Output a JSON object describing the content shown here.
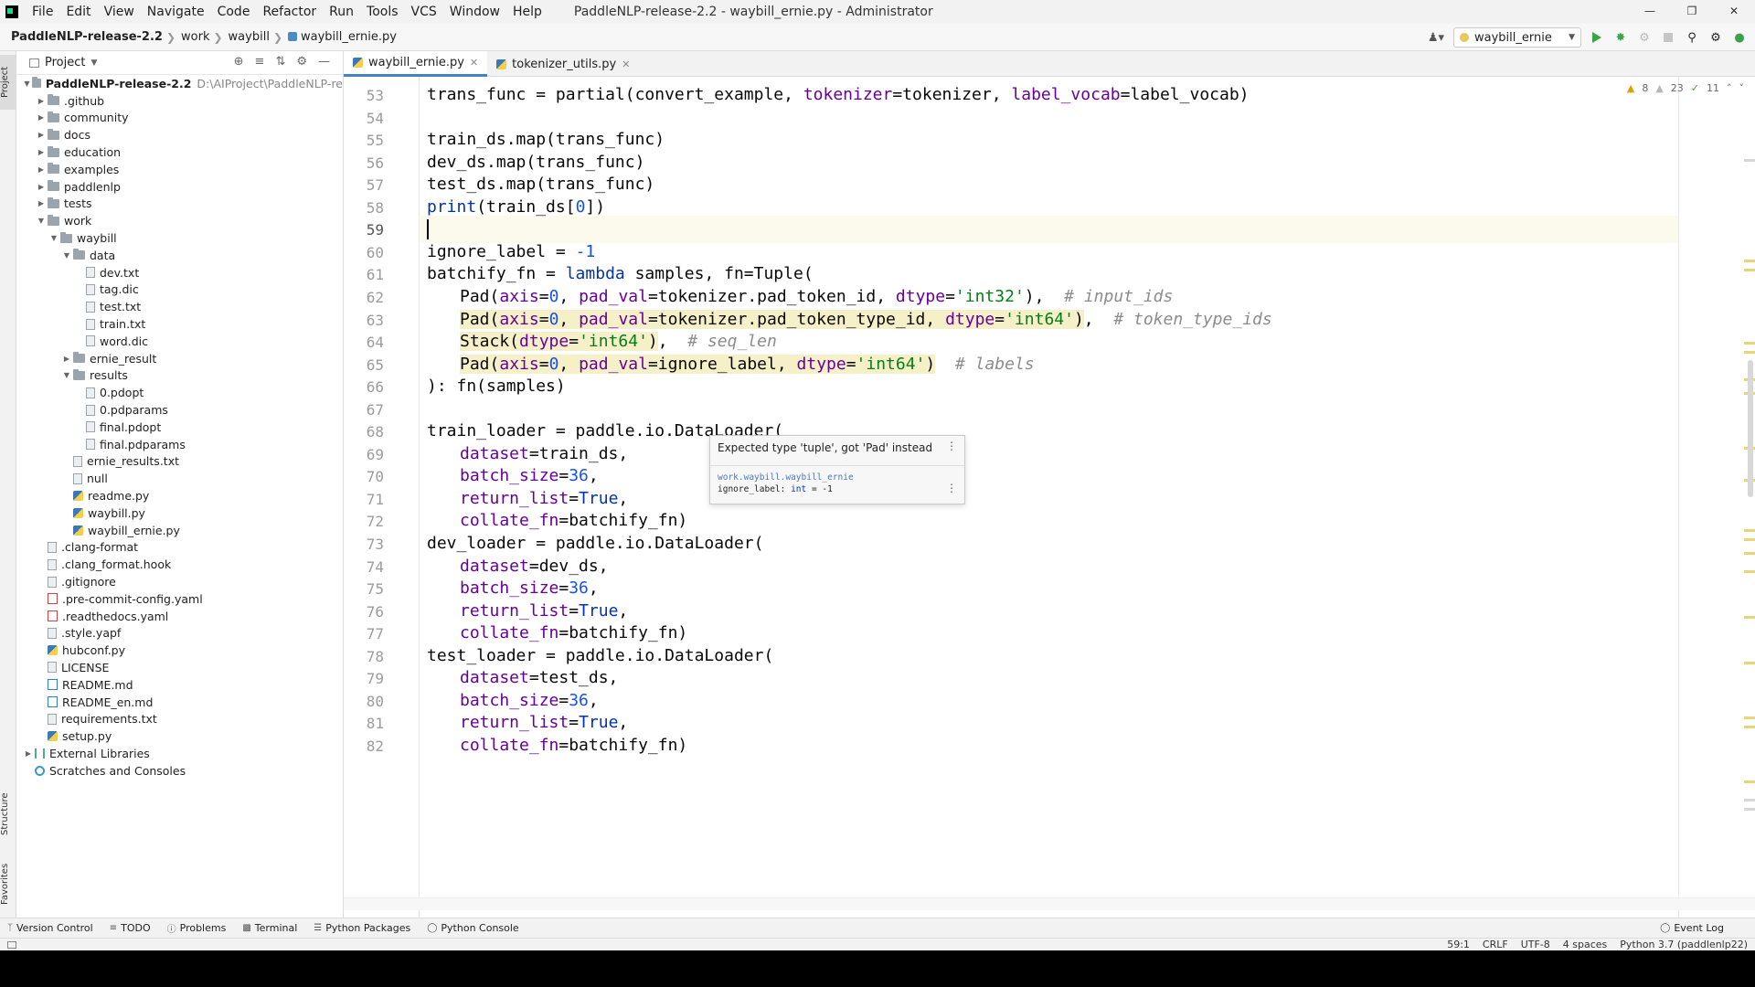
{
  "menubar": {
    "items": [
      "File",
      "Edit",
      "View",
      "Navigate",
      "Code",
      "Refactor",
      "Run",
      "Tools",
      "VCS",
      "Window",
      "Help"
    ],
    "window_title": "PaddleNLP-release-2.2 - waybill_ernie.py - Administrator"
  },
  "navbar": {
    "breadcrumbs": [
      "PaddleNLP-release-2.2",
      "work",
      "waybill",
      "waybill_ernie.py"
    ],
    "run_config": "waybill_ernie"
  },
  "side_tabs": {
    "project": "Project",
    "structure": "Structure",
    "favorites": "Favorites"
  },
  "project": {
    "title": "Project",
    "root": {
      "name": "PaddleNLP-release-2.2",
      "path": "D:\\AIProject\\PaddleNLP-re"
    },
    "tree": [
      {
        "label": ".github",
        "type": "folder",
        "depth": 1,
        "arrow": "right"
      },
      {
        "label": "community",
        "type": "folder",
        "depth": 1,
        "arrow": "right"
      },
      {
        "label": "docs",
        "type": "folder",
        "depth": 1,
        "arrow": "right"
      },
      {
        "label": "education",
        "type": "folder",
        "depth": 1,
        "arrow": "right"
      },
      {
        "label": "examples",
        "type": "folder",
        "depth": 1,
        "arrow": "right"
      },
      {
        "label": "paddlenlp",
        "type": "folder",
        "depth": 1,
        "arrow": "right"
      },
      {
        "label": "tests",
        "type": "folder",
        "depth": 1,
        "arrow": "right"
      },
      {
        "label": "work",
        "type": "folder",
        "depth": 1,
        "arrow": "down"
      },
      {
        "label": "waybill",
        "type": "folder",
        "depth": 2,
        "arrow": "down"
      },
      {
        "label": "data",
        "type": "folder",
        "depth": 3,
        "arrow": "down"
      },
      {
        "label": "dev.txt",
        "type": "file",
        "depth": 4,
        "arrow": ""
      },
      {
        "label": "tag.dic",
        "type": "file",
        "depth": 4,
        "arrow": ""
      },
      {
        "label": "test.txt",
        "type": "file",
        "depth": 4,
        "arrow": ""
      },
      {
        "label": "train.txt",
        "type": "file",
        "depth": 4,
        "arrow": ""
      },
      {
        "label": "word.dic",
        "type": "file",
        "depth": 4,
        "arrow": ""
      },
      {
        "label": "ernie_result",
        "type": "folder",
        "depth": 3,
        "arrow": "right"
      },
      {
        "label": "results",
        "type": "folder",
        "depth": 3,
        "arrow": "down"
      },
      {
        "label": "0.pdopt",
        "type": "file",
        "depth": 4,
        "arrow": ""
      },
      {
        "label": "0.pdparams",
        "type": "file",
        "depth": 4,
        "arrow": ""
      },
      {
        "label": "final.pdopt",
        "type": "file",
        "depth": 4,
        "arrow": ""
      },
      {
        "label": "final.pdparams",
        "type": "file",
        "depth": 4,
        "arrow": ""
      },
      {
        "label": "ernie_results.txt",
        "type": "file",
        "depth": 3,
        "arrow": ""
      },
      {
        "label": "null",
        "type": "file",
        "depth": 3,
        "arrow": ""
      },
      {
        "label": "readme.py",
        "type": "py",
        "depth": 3,
        "arrow": ""
      },
      {
        "label": "waybill.py",
        "type": "py",
        "depth": 3,
        "arrow": ""
      },
      {
        "label": "waybill_ernie.py",
        "type": "py",
        "depth": 3,
        "arrow": ""
      },
      {
        "label": ".clang-format",
        "type": "file",
        "depth": 1,
        "arrow": ""
      },
      {
        "label": ".clang_format.hook",
        "type": "file",
        "depth": 1,
        "arrow": ""
      },
      {
        "label": ".gitignore",
        "type": "file",
        "depth": 1,
        "arrow": ""
      },
      {
        "label": ".pre-commit-config.yaml",
        "type": "yaml",
        "depth": 1,
        "arrow": ""
      },
      {
        "label": ".readthedocs.yaml",
        "type": "yaml",
        "depth": 1,
        "arrow": ""
      },
      {
        "label": ".style.yapf",
        "type": "file",
        "depth": 1,
        "arrow": ""
      },
      {
        "label": "hubconf.py",
        "type": "py",
        "depth": 1,
        "arrow": ""
      },
      {
        "label": "LICENSE",
        "type": "file",
        "depth": 1,
        "arrow": ""
      },
      {
        "label": "README.md",
        "type": "md",
        "depth": 1,
        "arrow": ""
      },
      {
        "label": "README_en.md",
        "type": "md",
        "depth": 1,
        "arrow": ""
      },
      {
        "label": "requirements.txt",
        "type": "file",
        "depth": 1,
        "arrow": ""
      },
      {
        "label": "setup.py",
        "type": "py",
        "depth": 1,
        "arrow": ""
      },
      {
        "label": "External Libraries",
        "type": "lib",
        "depth": 0,
        "arrow": "right"
      },
      {
        "label": "Scratches and Consoles",
        "type": "scratch",
        "depth": 0,
        "arrow": ""
      }
    ]
  },
  "editor": {
    "tabs": [
      {
        "label": "waybill_ernie.py",
        "active": true
      },
      {
        "label": "tokenizer_utils.py",
        "active": false
      }
    ],
    "inspections": {
      "warnings": "8",
      "weak_warnings": "23",
      "ok": "11"
    },
    "current_line": 59,
    "lines": [
      {
        "n": 53,
        "indent": 0,
        "tokens": [
          [
            "trans_func = partial(convert_example, ",
            ""
          ],
          [
            "tokenizer",
            "param"
          ],
          [
            "=tokenizer, ",
            ""
          ],
          [
            "label_vocab",
            "param"
          ],
          [
            "=label_vocab)",
            ""
          ]
        ]
      },
      {
        "n": 54,
        "indent": 0,
        "tokens": []
      },
      {
        "n": 55,
        "indent": 0,
        "tokens": [
          [
            "train_ds.map(trans_func)",
            ""
          ]
        ]
      },
      {
        "n": 56,
        "indent": 0,
        "tokens": [
          [
            "dev_ds.map(trans_func)",
            ""
          ]
        ]
      },
      {
        "n": 57,
        "indent": 0,
        "tokens": [
          [
            "test_ds.map(trans_func)",
            ""
          ]
        ]
      },
      {
        "n": 58,
        "indent": 0,
        "tokens": [
          [
            "print",
            "kw"
          ],
          [
            "(train_ds[",
            ""
          ],
          [
            "0",
            "num"
          ],
          [
            "])",
            ""
          ]
        ]
      },
      {
        "n": 59,
        "indent": 0,
        "tokens": []
      },
      {
        "n": 60,
        "indent": 0,
        "tokens": [
          [
            "ignore_label = ",
            ""
          ],
          [
            "-1",
            "num"
          ]
        ]
      },
      {
        "n": 61,
        "indent": 0,
        "tokens": [
          [
            "batchify_fn = ",
            ""
          ],
          [
            "lambda",
            "kw"
          ],
          [
            " samples, fn=Tuple(",
            ""
          ]
        ]
      },
      {
        "n": 62,
        "indent": 1,
        "tokens": [
          [
            "Pad(",
            ""
          ],
          [
            "axis",
            "param"
          ],
          [
            "=",
            ""
          ],
          [
            "0",
            "num"
          ],
          [
            ", ",
            ""
          ],
          [
            "pad_val",
            "param"
          ],
          [
            "=tokenizer.pad_token_id, ",
            ""
          ],
          [
            "dtype",
            "param"
          ],
          [
            "=",
            ""
          ],
          [
            "'int32'",
            "str"
          ],
          [
            "),  ",
            ""
          ],
          [
            "# input_ids",
            "cmt"
          ]
        ]
      },
      {
        "n": 63,
        "indent": 1,
        "hl": true,
        "tokens": [
          [
            "Pad(",
            ""
          ],
          [
            "axis",
            "param"
          ],
          [
            "=",
            ""
          ],
          [
            "0",
            "num"
          ],
          [
            ", ",
            ""
          ],
          [
            "pad_val",
            "param"
          ],
          [
            "=tokenizer.pad_token_type_id, ",
            ""
          ],
          [
            "dtype",
            "param"
          ],
          [
            "=",
            ""
          ],
          [
            "'int64'",
            "str"
          ],
          [
            ")",
            ""
          ],
          [
            ",  ",
            ""
          ],
          [
            "# token_type_ids",
            "cmt"
          ]
        ]
      },
      {
        "n": 64,
        "indent": 1,
        "hl": true,
        "tokens": [
          [
            "Stack(",
            ""
          ],
          [
            "dtype",
            "param"
          ],
          [
            "=",
            ""
          ],
          [
            "'int64'",
            "str"
          ],
          [
            ")",
            ""
          ],
          [
            ",  ",
            ""
          ],
          [
            "# seq_len",
            "cmt"
          ]
        ]
      },
      {
        "n": 65,
        "indent": 1,
        "hl": true,
        "tokens": [
          [
            "Pad(",
            ""
          ],
          [
            "axis",
            "param"
          ],
          [
            "=",
            ""
          ],
          [
            "0",
            "num"
          ],
          [
            ", ",
            ""
          ],
          [
            "pad_val",
            "param"
          ],
          [
            "=ignore_label, ",
            ""
          ],
          [
            "dtype",
            "param"
          ],
          [
            "=",
            ""
          ],
          [
            "'int64'",
            "str"
          ],
          [
            ")",
            ""
          ],
          [
            "  ",
            ""
          ],
          [
            "# labels",
            "cmt"
          ]
        ]
      },
      {
        "n": 66,
        "indent": 0,
        "tokens": [
          [
            "): fn(samples)",
            ""
          ]
        ]
      },
      {
        "n": 67,
        "indent": 0,
        "tokens": []
      },
      {
        "n": 68,
        "indent": 0,
        "tokens": [
          [
            "train_loader = paddle.io.DataLoader(",
            ""
          ]
        ]
      },
      {
        "n": 69,
        "indent": 1,
        "tokens": [
          [
            "dataset",
            "param"
          ],
          [
            "=train_ds,",
            ""
          ]
        ]
      },
      {
        "n": 70,
        "indent": 1,
        "tokens": [
          [
            "batch_size",
            "param"
          ],
          [
            "=",
            ""
          ],
          [
            "36",
            "num"
          ],
          [
            ",",
            ""
          ]
        ]
      },
      {
        "n": 71,
        "indent": 1,
        "tokens": [
          [
            "return_list",
            "param"
          ],
          [
            "=",
            ""
          ],
          [
            "True",
            "kw"
          ],
          [
            ",",
            ""
          ]
        ]
      },
      {
        "n": 72,
        "indent": 1,
        "tokens": [
          [
            "collate_fn",
            "param"
          ],
          [
            "=batchify_fn)",
            ""
          ]
        ]
      },
      {
        "n": 73,
        "indent": 0,
        "tokens": [
          [
            "dev_loader = paddle.io.DataLoader(",
            ""
          ]
        ]
      },
      {
        "n": 74,
        "indent": 1,
        "tokens": [
          [
            "dataset",
            "param"
          ],
          [
            "=dev_ds,",
            ""
          ]
        ]
      },
      {
        "n": 75,
        "indent": 1,
        "tokens": [
          [
            "batch_size",
            "param"
          ],
          [
            "=",
            ""
          ],
          [
            "36",
            "num"
          ],
          [
            ",",
            ""
          ]
        ]
      },
      {
        "n": 76,
        "indent": 1,
        "tokens": [
          [
            "return_list",
            "param"
          ],
          [
            "=",
            ""
          ],
          [
            "True",
            "kw"
          ],
          [
            ",",
            ""
          ]
        ]
      },
      {
        "n": 77,
        "indent": 1,
        "tokens": [
          [
            "collate_fn",
            "param"
          ],
          [
            "=batchify_fn)",
            ""
          ]
        ]
      },
      {
        "n": 78,
        "indent": 0,
        "tokens": [
          [
            "test_loader = paddle.io.DataLoader(",
            ""
          ]
        ]
      },
      {
        "n": 79,
        "indent": 1,
        "tokens": [
          [
            "dataset",
            "param"
          ],
          [
            "=test_ds,",
            ""
          ]
        ]
      },
      {
        "n": 80,
        "indent": 1,
        "tokens": [
          [
            "batch_size",
            "param"
          ],
          [
            "=",
            ""
          ],
          [
            "36",
            "num"
          ],
          [
            ",",
            ""
          ]
        ]
      },
      {
        "n": 81,
        "indent": 1,
        "tokens": [
          [
            "return_list",
            "param"
          ],
          [
            "=",
            ""
          ],
          [
            "True",
            "kw"
          ],
          [
            ",",
            ""
          ]
        ]
      },
      {
        "n": 82,
        "indent": 1,
        "tokens": [
          [
            "collate_fn",
            "param"
          ],
          [
            "=batchify_fn)",
            ""
          ]
        ]
      }
    ]
  },
  "tooltip": {
    "message": "Expected type 'tuple', got 'Pad' instead",
    "module": "work.waybill.waybill_ernie",
    "decl_name": "ignore_label: ",
    "decl_type": "int",
    "decl_value": " = -1"
  },
  "bottom_tools": [
    "Version Control",
    "TODO",
    "Problems",
    "Terminal",
    "Python Packages",
    "Python Console"
  ],
  "event_log": "Event Log",
  "status": [
    "59:1",
    "CRLF",
    "UTF-8",
    "4 spaces",
    "Python 3.7 (paddlenlp22)"
  ]
}
